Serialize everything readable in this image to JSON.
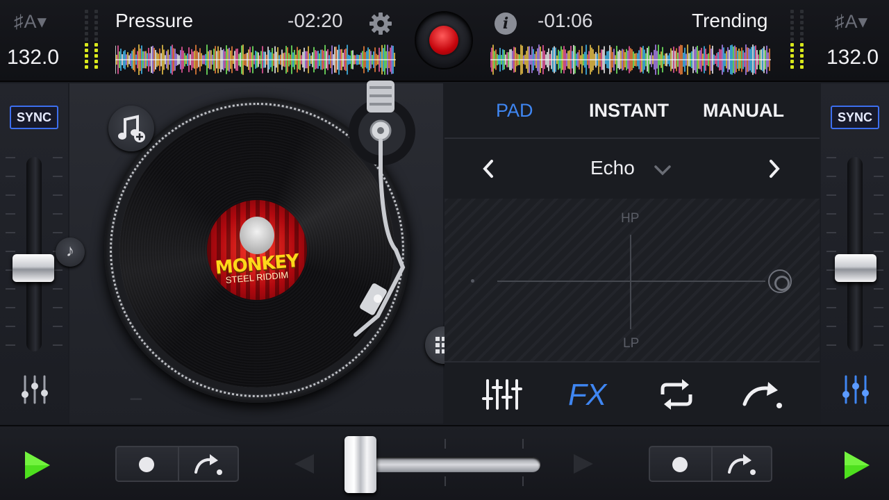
{
  "deck_a": {
    "key": "♯A▾",
    "bpm": "132.0",
    "track_title": "Pressure",
    "time_remaining": "-02:20",
    "sync_label": "SYNC",
    "record_label_title": "MONKEY",
    "record_label_subtitle": "STEEL RIDDIM"
  },
  "deck_b": {
    "key": "♯A▾",
    "bpm": "132.0",
    "track_title": "Trending",
    "time_remaining": "-01:06",
    "sync_label": "SYNC"
  },
  "fx_panel": {
    "tabs": [
      {
        "label": "PAD",
        "active": true
      },
      {
        "label": "INSTANT",
        "active": false
      },
      {
        "label": "MANUAL",
        "active": false
      }
    ],
    "effect_name": "Echo",
    "pad_top_label": "HP",
    "pad_bottom_label": "LP",
    "fx_button_label": "FX"
  },
  "colors": {
    "accent_blue": "#3f86f2",
    "record_red": "#d30b12",
    "play_green": "#4ee01e",
    "meter_yellow": "#d9e81c"
  },
  "icons": {
    "settings": "gear-icon",
    "info": "info-icon",
    "record": "record-button",
    "add_music": "music-add-icon",
    "note": "music-note-icon",
    "grid": "grid-icon",
    "mixer": "mixer-sliders-icon",
    "loop": "loop-icon",
    "redo": "redo-arrow-icon",
    "play": "play-icon"
  }
}
